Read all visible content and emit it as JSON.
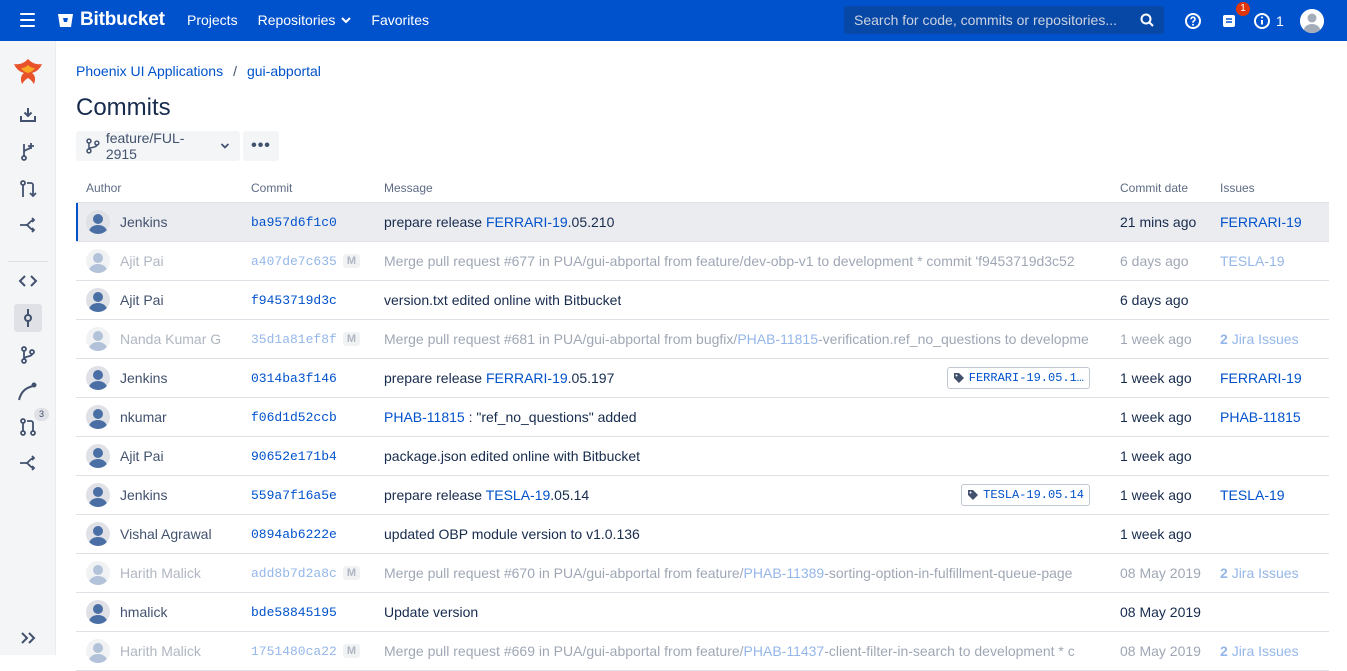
{
  "app": {
    "name": "Bitbucket"
  },
  "topnav": {
    "projects": "Projects",
    "repositories": "Repositories",
    "favorites": "Favorites"
  },
  "search": {
    "placeholder": "Search for code, commits or repositories..."
  },
  "notifications": {
    "count": "1"
  },
  "info": {
    "count": "1"
  },
  "breadcrumb": {
    "project": "Phoenix UI Applications",
    "separator": "/",
    "repo": "gui-abportal"
  },
  "page": {
    "title": "Commits"
  },
  "branch": {
    "name": "feature/FUL-2915",
    "more": "•••"
  },
  "sidebar": {
    "pr_count": "3"
  },
  "table": {
    "headers": {
      "author": "Author",
      "commit": "Commit",
      "message": "Message",
      "date": "Commit date",
      "issues": "Issues"
    },
    "rows": [
      {
        "author": "Jenkins",
        "hash": "ba957d6f1c0",
        "merge": false,
        "selected": true,
        "msg": [
          {
            "t": "prepare release "
          },
          {
            "t": "FERRARI-19",
            "link": true
          },
          {
            "t": ".05.210"
          }
        ],
        "tag": "",
        "date": "21 mins ago",
        "issue": "FERRARI-19",
        "issue_count": ""
      },
      {
        "author": "Ajit Pai",
        "hash": "a407de7c635",
        "merge": true,
        "selected": false,
        "msg": [
          {
            "t": "Merge pull request #677 in PUA/gui-abportal from feature/dev-obp-v1 to development * commit 'f9453719d3c52"
          }
        ],
        "tag": "",
        "date": "6 days ago",
        "issue": "TESLA-19",
        "issue_count": ""
      },
      {
        "author": "Ajit Pai",
        "hash": "f9453719d3c",
        "merge": false,
        "selected": false,
        "msg": [
          {
            "t": "version.txt edited online with Bitbucket"
          }
        ],
        "tag": "",
        "date": "6 days ago",
        "issue": "",
        "issue_count": ""
      },
      {
        "author": "Nanda Kumar G",
        "hash": "35d1a81ef8f",
        "merge": true,
        "selected": false,
        "msg": [
          {
            "t": "Merge pull request #681 in PUA/gui-abportal from bugfix/"
          },
          {
            "t": "PHAB-11815",
            "link": true
          },
          {
            "t": "-verification.ref_no_questions to developme"
          }
        ],
        "tag": "",
        "date": "1 week ago",
        "issue": "Jira Issues",
        "issue_count": "2"
      },
      {
        "author": "Jenkins",
        "hash": "0314ba3f146",
        "merge": false,
        "selected": false,
        "msg": [
          {
            "t": "prepare release "
          },
          {
            "t": "FERRARI-19",
            "link": true
          },
          {
            "t": ".05.197"
          }
        ],
        "tag": "FERRARI-19.05.1…",
        "date": "1 week ago",
        "issue": "FERRARI-19",
        "issue_count": ""
      },
      {
        "author": "nkumar",
        "hash": "f06d1d52ccb",
        "merge": false,
        "selected": false,
        "msg": [
          {
            "t": "PHAB-11815",
            "link": true
          },
          {
            "t": " : \"ref_no_questions\" added"
          }
        ],
        "tag": "",
        "date": "1 week ago",
        "issue": "PHAB-11815",
        "issue_count": ""
      },
      {
        "author": "Ajit Pai",
        "hash": "90652e171b4",
        "merge": false,
        "selected": false,
        "msg": [
          {
            "t": "package.json edited online with Bitbucket"
          }
        ],
        "tag": "",
        "date": "1 week ago",
        "issue": "",
        "issue_count": ""
      },
      {
        "author": "Jenkins",
        "hash": "559a7f16a5e",
        "merge": false,
        "selected": false,
        "msg": [
          {
            "t": "prepare release "
          },
          {
            "t": "TESLA-19",
            "link": true
          },
          {
            "t": ".05.14"
          }
        ],
        "tag": "TESLA-19.05.14",
        "date": "1 week ago",
        "issue": "TESLA-19",
        "issue_count": ""
      },
      {
        "author": "Vishal Agrawal",
        "hash": "0894ab6222e",
        "merge": false,
        "selected": false,
        "msg": [
          {
            "t": "updated OBP module version to v1.0.136"
          }
        ],
        "tag": "",
        "date": "1 week ago",
        "issue": "",
        "issue_count": ""
      },
      {
        "author": "Harith Malick",
        "hash": "add8b7d2a8c",
        "merge": true,
        "selected": false,
        "msg": [
          {
            "t": "Merge pull request #670 in PUA/gui-abportal from feature/"
          },
          {
            "t": "PHAB-11389",
            "link": true
          },
          {
            "t": "-sorting-option-in-fulfillment-queue-page"
          }
        ],
        "tag": "",
        "date": "08 May 2019",
        "issue": "Jira Issues",
        "issue_count": "2"
      },
      {
        "author": "hmalick",
        "hash": "bde58845195",
        "merge": false,
        "selected": false,
        "msg": [
          {
            "t": "Update version"
          }
        ],
        "tag": "",
        "date": "08 May 2019",
        "issue": "",
        "issue_count": ""
      },
      {
        "author": "Harith Malick",
        "hash": "1751480ca22",
        "merge": true,
        "selected": false,
        "msg": [
          {
            "t": "Merge pull request #669 in PUA/gui-abportal from feature/"
          },
          {
            "t": "PHAB-11437",
            "link": true
          },
          {
            "t": "-client-filter-in-search to development * c"
          }
        ],
        "tag": "",
        "date": "08 May 2019",
        "issue": "Jira Issues",
        "issue_count": "2"
      }
    ]
  }
}
